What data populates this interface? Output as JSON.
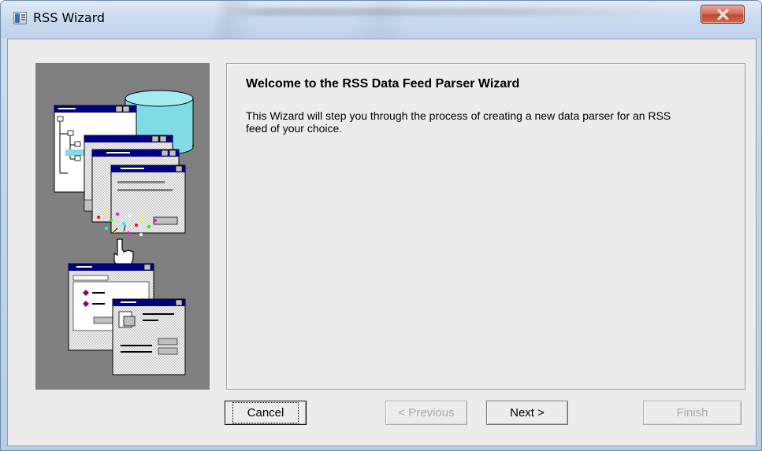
{
  "window": {
    "title": "RSS Wizard",
    "close_icon": "close-x-icon"
  },
  "wizard": {
    "heading": "Welcome to the RSS Data Feed Parser Wizard",
    "description": "This Wizard will step you through the process of creating a new data parser for an RSS feed of your choice.",
    "illustration": "wizard-illustration"
  },
  "buttons": {
    "cancel": "Cancel",
    "previous": "< Previous",
    "next": "Next >",
    "finish": "Finish"
  },
  "colors": {
    "dialog_bg": "#ececec",
    "side_panel": "#808080",
    "cylinder": "#7fdce6",
    "window_accent": "#000080",
    "close_button": "#c9432f"
  }
}
